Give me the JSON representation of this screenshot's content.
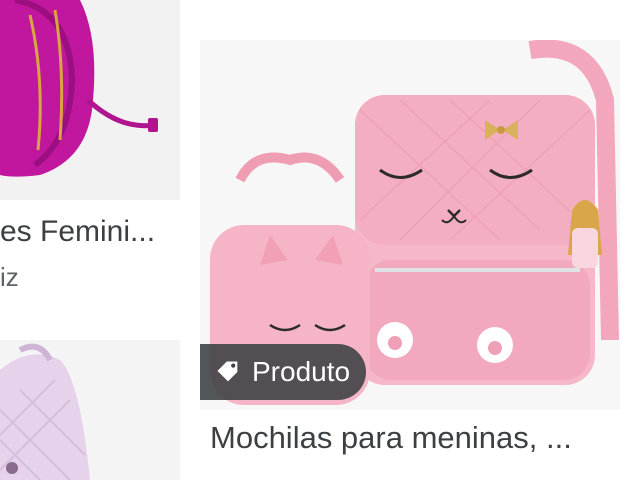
{
  "results": [
    {
      "title": "es Femini...",
      "source": "iz",
      "image": "magenta-backpack"
    },
    {
      "title": "",
      "source": "",
      "image": "lilac-backpack"
    },
    {
      "title": "Mochilas para meninas, ...",
      "source": "",
      "badge": {
        "label": "Produto",
        "icon": "tag-icon"
      },
      "image": "pink-cat-backpack-set"
    }
  ],
  "colors": {
    "magenta": "#c0179e",
    "pink_light": "#f6b8c8",
    "pink_mid": "#ef9db4",
    "lilac": "#e6d2ea",
    "badge_bg": "#3c4043"
  }
}
